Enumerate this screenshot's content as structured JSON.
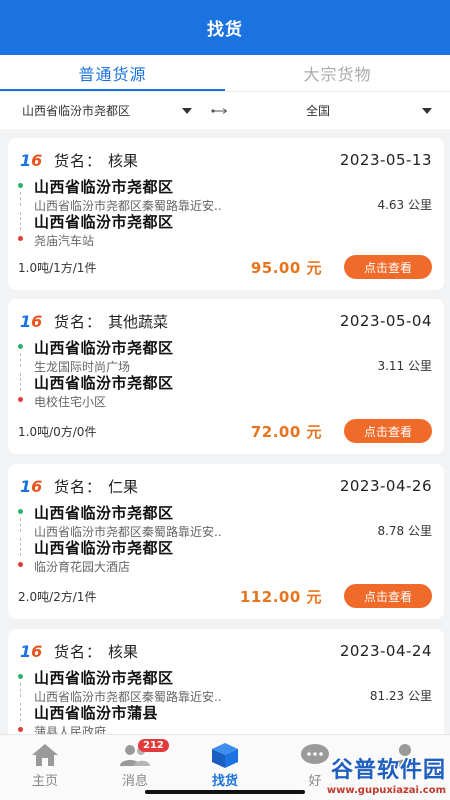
{
  "header": {
    "title": "找货"
  },
  "tabs": [
    {
      "label": "普通货源",
      "active": true
    },
    {
      "label": "大宗货物",
      "active": false
    }
  ],
  "filter": {
    "origin": "山西省临汾市尧都区",
    "destination": "全国"
  },
  "goods_label": "货名：",
  "view_button_label": "点击查看",
  "cards": [
    {
      "name": "核果",
      "date": "2023-05-13",
      "from_city": "山西省临汾市尧都区",
      "from_addr": "山西省临汾市尧都区秦蜀路靠近安..",
      "to_city": "山西省临汾市尧都区",
      "to_addr": "尧庙汽车站",
      "distance": "4.63 公里",
      "spec": "1.0吨/1方/1件",
      "price": "95.00 元"
    },
    {
      "name": "其他蔬菜",
      "date": "2023-05-04",
      "from_city": "山西省临汾市尧都区",
      "from_addr": "生龙国际时尚广场",
      "to_city": "山西省临汾市尧都区",
      "to_addr": "电校住宅小区",
      "distance": "3.11 公里",
      "spec": "1.0吨/0方/0件",
      "price": "72.00 元"
    },
    {
      "name": "仁果",
      "date": "2023-04-26",
      "from_city": "山西省临汾市尧都区",
      "from_addr": "山西省临汾市尧都区秦蜀路靠近安..",
      "to_city": "山西省临汾市尧都区",
      "to_addr": "临汾育花园大酒店",
      "distance": "8.78 公里",
      "spec": "2.0吨/2方/1件",
      "price": "112.00 元"
    },
    {
      "name": "核果",
      "date": "2023-04-24",
      "from_city": "山西省临汾市尧都区",
      "from_addr": "山西省临汾市尧都区秦蜀路靠近安..",
      "to_city": "山西省临汾市蒲县",
      "to_addr": "蒲县人民政府",
      "distance": "81.23 公里",
      "spec": "",
      "price": ""
    }
  ],
  "tabbar": [
    {
      "label": "主页",
      "icon": "home-icon",
      "active": false
    },
    {
      "label": "消息",
      "icon": "people-icon",
      "active": false,
      "badge": "212"
    },
    {
      "label": "找货",
      "icon": "cube-icon",
      "active": true
    },
    {
      "label": "好",
      "icon": "chat-icon",
      "active": false
    },
    {
      "label": "",
      "icon": "user-icon",
      "active": false
    }
  ],
  "watermark": {
    "text": "谷普软件园",
    "url": "www.gupuxiazai.com"
  },
  "colors": {
    "primary": "#1a73e0",
    "accent": "#f06a2a",
    "price": "#e8741e",
    "green_dot": "#29b36b",
    "red_dot": "#e23b3b"
  }
}
